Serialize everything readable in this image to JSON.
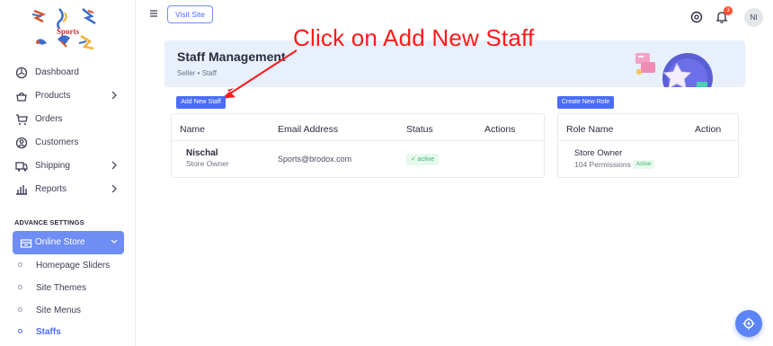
{
  "sidebar": {
    "logo_text": "Sports",
    "items": [
      {
        "label": "Dashboard",
        "icon": "dashboard-icon",
        "has_chevron": false
      },
      {
        "label": "Products",
        "icon": "products-icon",
        "has_chevron": true
      },
      {
        "label": "Orders",
        "icon": "orders-icon",
        "has_chevron": false
      },
      {
        "label": "Customers",
        "icon": "customers-icon",
        "has_chevron": false
      },
      {
        "label": "Shipping",
        "icon": "shipping-icon",
        "has_chevron": true
      },
      {
        "label": "Reports",
        "icon": "reports-icon",
        "has_chevron": true
      }
    ],
    "section_heading": "ADVANCE SETTINGS",
    "online_store": {
      "label": "Online Store",
      "icon": "store-icon"
    },
    "sub_items": [
      {
        "label": "Homepage Sliders",
        "active": false
      },
      {
        "label": "Site Themes",
        "active": false
      },
      {
        "label": "Site Menus",
        "active": false
      },
      {
        "label": "Staffs",
        "active": true
      }
    ]
  },
  "topbar": {
    "visit_site_label": "Visit Site",
    "notification_count": "3",
    "avatar_initials": "NI"
  },
  "annotation": {
    "text": "Click on Add New Staff",
    "color": "#ff1a1a"
  },
  "banner": {
    "title": "Staff Management",
    "breadcrumb": "Seller • Staff"
  },
  "staff_section": {
    "add_button_label": "Add New Staff",
    "columns": [
      "Name",
      "Email Address",
      "Status",
      "Actions"
    ],
    "rows": [
      {
        "name": "Nischal",
        "role": "Store Owner",
        "email": "Sports@brodox.com",
        "status": "✓ active"
      }
    ]
  },
  "roles_section": {
    "create_button_label": "Create New Role",
    "columns": [
      "Role Name",
      "Action"
    ],
    "rows": [
      {
        "name": "Store Owner",
        "permissions": "104 Permissions",
        "status": "Active"
      }
    ]
  },
  "colors": {
    "accent": "#4a6cf7",
    "sidebar_active": "#6e8ef5",
    "banner_bg": "#e7f0fb",
    "status_green": "#38b56a"
  }
}
